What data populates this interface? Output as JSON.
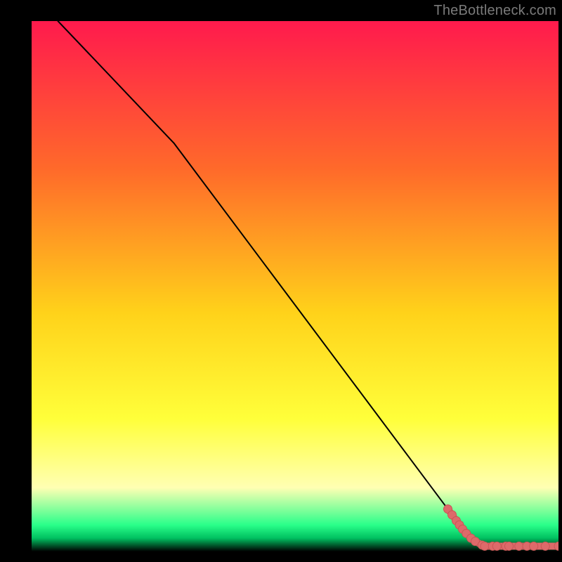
{
  "watermark": "TheBottleneck.com",
  "gradient": {
    "top": "#ff1a4d",
    "mid_upper": "#ff6a2a",
    "mid": "#ffd21a",
    "mid_lower": "#ffff3a",
    "pale": "#ffffb3",
    "green_light": "#2aff8a",
    "green_deep": "#00c060",
    "black": "#000000"
  },
  "line_color": "#000000",
  "marker_color": "#dd6a6a",
  "marker_stroke": "#c95555",
  "chart_data": {
    "type": "line",
    "title": "",
    "xlabel": "",
    "ylabel": "",
    "xlim": [
      0,
      100
    ],
    "ylim": [
      0,
      100
    ],
    "series": [
      {
        "name": "curve",
        "x": [
          5,
          27,
          82,
          86,
          100
        ],
        "y": [
          100,
          77,
          4,
          1,
          1
        ]
      }
    ],
    "segment_markers": {
      "name": "highlight",
      "points": [
        {
          "x": 79.0,
          "y": 8.0
        },
        {
          "x": 79.8,
          "y": 6.9
        },
        {
          "x": 80.6,
          "y": 5.8
        },
        {
          "x": 81.2,
          "y": 5.0
        },
        {
          "x": 81.8,
          "y": 4.2
        },
        {
          "x": 82.5,
          "y": 3.4
        },
        {
          "x": 83.4,
          "y": 2.5
        },
        {
          "x": 84.2,
          "y": 1.9
        },
        {
          "x": 85.5,
          "y": 1.2
        },
        {
          "x": 86.0,
          "y": 1.0
        },
        {
          "x": 87.5,
          "y": 1.0
        },
        {
          "x": 88.3,
          "y": 1.0
        },
        {
          "x": 90.0,
          "y": 1.0
        },
        {
          "x": 90.6,
          "y": 1.0
        },
        {
          "x": 92.5,
          "y": 1.0
        },
        {
          "x": 94.0,
          "y": 1.0
        },
        {
          "x": 95.3,
          "y": 1.0
        },
        {
          "x": 97.5,
          "y": 1.0
        },
        {
          "x": 100.0,
          "y": 1.0
        }
      ]
    }
  }
}
